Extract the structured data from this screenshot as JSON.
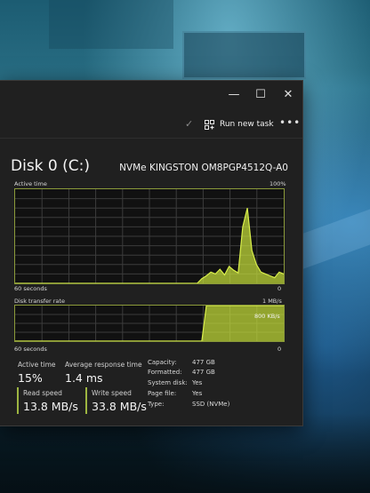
{
  "window": {
    "controls": {
      "minimize": "—",
      "maximize": "☐",
      "close": "✕"
    },
    "toolbar": {
      "run_new_task": "Run new task",
      "more": "•••"
    }
  },
  "disk": {
    "title": "Disk 0 (C:)",
    "model": "NVMe KINGSTON OM8PGP4512Q-A0"
  },
  "active_time_graph": {
    "label": "Active time",
    "max_label": "100%",
    "x_label": "60 seconds",
    "min_label": "0"
  },
  "transfer_graph": {
    "label": "Disk transfer rate",
    "max_label": "1 MB/s",
    "mid_label": "800 KB/s",
    "x_label": "60 seconds",
    "min_label": "0"
  },
  "stats": {
    "active_time": {
      "label": "Active time",
      "value": "15%"
    },
    "response_time": {
      "label": "Average response time",
      "value": "1.4 ms"
    },
    "read_speed": {
      "label": "Read speed",
      "value": "13.8 MB/s"
    },
    "write_speed": {
      "label": "Write speed",
      "value": "33.8 MB/s"
    }
  },
  "properties": [
    {
      "key": "Capacity:",
      "value": "477 GB"
    },
    {
      "key": "Formatted:",
      "value": "477 GB"
    },
    {
      "key": "System disk:",
      "value": "Yes"
    },
    {
      "key": "Page file:",
      "value": "Yes"
    },
    {
      "key": "Type:",
      "value": "SSD (NVMe)"
    }
  ],
  "colors": {
    "accent": "#9db541",
    "graph_fill": "#c9e23a",
    "window_bg": "#202020"
  },
  "chart_data": [
    {
      "type": "area",
      "series": [
        {
          "values": [
            0,
            0,
            0,
            0,
            0,
            0,
            0,
            0,
            0,
            0,
            0,
            0,
            0,
            0,
            0,
            0,
            0,
            0,
            0,
            0,
            0,
            0,
            0,
            0,
            0,
            0,
            0,
            0,
            0,
            0,
            0,
            0,
            0,
            0,
            0,
            0,
            0,
            0,
            0,
            0,
            0,
            5,
            8,
            12,
            10,
            15,
            9,
            18,
            14,
            11,
            60,
            80,
            35,
            20,
            12,
            10,
            8,
            6,
            12,
            10
          ]
        }
      ],
      "ylim": [
        0,
        100
      ]
    },
    {
      "type": "area",
      "series": [
        {
          "values": [
            0,
            0,
            0,
            0,
            0,
            0,
            0,
            0,
            0,
            0,
            0,
            0,
            0,
            0,
            0,
            0,
            0,
            0,
            0,
            0,
            0,
            0,
            0,
            0,
            0,
            0,
            0,
            0,
            0,
            0,
            0,
            0,
            0,
            0,
            0,
            0,
            0,
            0,
            0,
            0,
            0,
            0,
            100,
            100,
            100,
            100,
            100,
            100,
            100,
            100,
            100,
            100,
            100,
            100,
            100,
            100,
            100,
            100,
            100,
            100
          ]
        }
      ],
      "ylim": [
        0,
        100
      ]
    }
  ]
}
